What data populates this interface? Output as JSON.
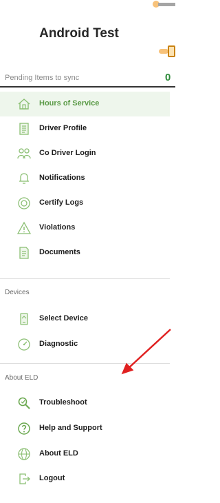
{
  "header": {
    "title": "Android Test"
  },
  "sync": {
    "label": "Pending Items to sync",
    "count": "0"
  },
  "menu": {
    "hours": "Hours of Service",
    "driver_profile": "Driver Profile",
    "co_driver": "Co Driver Login",
    "notifications": "Notifications",
    "certify": "Certify Logs",
    "violations": "Violations",
    "documents": "Documents"
  },
  "devices": {
    "header": "Devices",
    "select_device": "Select Device",
    "diagnostic": "Diagnostic"
  },
  "about": {
    "header": "About ELD",
    "troubleshoot": "Troubleshoot",
    "help": "Help and Support",
    "about_eld": "About ELD",
    "logout": "Logout"
  },
  "colors": {
    "accent_green": "#6aa84f",
    "active_bg": "#eef6ec",
    "annotation_arrow": "#e02020"
  }
}
